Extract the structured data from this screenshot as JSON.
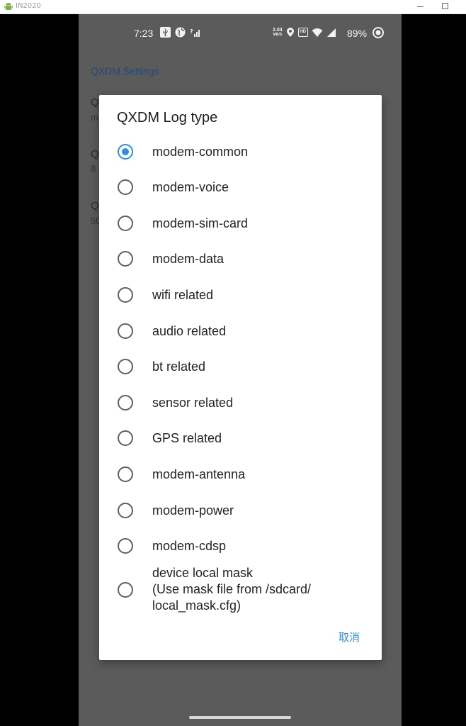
{
  "window": {
    "title": "IN2020",
    "app_icon": "android-icon"
  },
  "statusbar": {
    "time": "7:23",
    "net_speed_value": "2.04",
    "net_speed_unit": "MB/S",
    "volte_label": "HD",
    "battery_percent": "89%",
    "icons": [
      "usb-icon",
      "globe-icon",
      "signal-bars-icon",
      "location-pin-icon",
      "volte-icon",
      "wifi-icon",
      "cell-signal-icon",
      "battery-icon"
    ]
  },
  "background": {
    "header": "QXDM Settings",
    "fragments": [
      "Q",
      "m",
      "Q",
      "8",
      "Q",
      "50"
    ]
  },
  "dialog": {
    "title": "QXDM Log type",
    "cancel_label": "取消",
    "selected_index": 0,
    "accent_color": "#2e8ee5",
    "options": [
      {
        "label": "modem-common"
      },
      {
        "label": "modem-voice"
      },
      {
        "label": "modem-sim-card"
      },
      {
        "label": "modem-data"
      },
      {
        "label": "wifi related"
      },
      {
        "label": "audio related"
      },
      {
        "label": "bt related"
      },
      {
        "label": "sensor related"
      },
      {
        "label": "GPS related"
      },
      {
        "label": "modem-antenna"
      },
      {
        "label": "modem-power"
      },
      {
        "label": "modem-cdsp"
      },
      {
        "label_lines": [
          "device local mask",
          "(Use mask file from /sdcard/",
          "local_mask.cfg)"
        ]
      }
    ]
  }
}
